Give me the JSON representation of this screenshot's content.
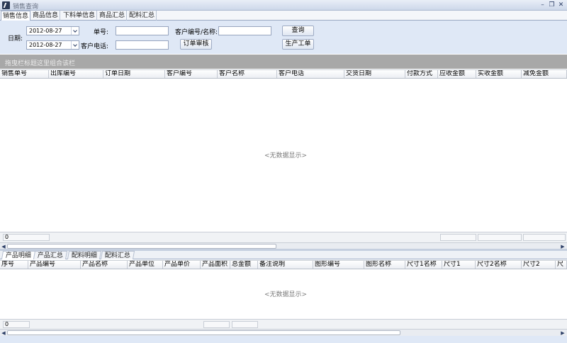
{
  "window": {
    "title": "销售查询",
    "minimize_glyph": "–",
    "restore_glyph": "❐",
    "close_glyph": "✕"
  },
  "top_tabs": [
    "销售信息",
    "商品信息",
    "下料单信息",
    "商品汇总",
    "配料汇总"
  ],
  "filters": {
    "date_label": "日期:",
    "date_from": "2012-08-27",
    "date_to": "2012-08-27",
    "order_no_label": "单号:",
    "order_no_value": "",
    "customer_phone_label": "客户电话:",
    "customer_phone_value": "",
    "customer_code_label": "客户编号/名称:",
    "customer_code_value": "",
    "query_button": "查询",
    "order_review_button": "订单审核",
    "production_order_button": "生产工单"
  },
  "group_panel": {
    "hint": "拖曳栏标题这里组合该栏"
  },
  "sales_grid": {
    "columns": [
      "销售单号",
      "出库编号",
      "订单日期",
      "客户编号",
      "客户名称",
      "客户电话",
      "交货日期",
      "付款方式",
      "应收金额",
      "实收金额",
      "减免金额"
    ],
    "empty_text": "<无数据显示>",
    "footer_count": "0"
  },
  "bottom_tabs": [
    "产品明细",
    "产品汇总",
    "配料明细",
    "配料汇总"
  ],
  "detail_grid": {
    "columns": [
      "序号",
      "产品编号",
      "产品名称",
      "产品单位",
      "产品单价",
      "产品面积",
      "总金额",
      "备注说明",
      "图形编号",
      "图形名称",
      "尺寸1名称",
      "尺寸1",
      "尺寸2名称",
      "尺寸2",
      "尺"
    ],
    "empty_text": "<无数据显示>",
    "footer_count": "0"
  },
  "icons": {
    "app": "app-icon",
    "scroll_left": "◀",
    "scroll_right": "▶"
  }
}
